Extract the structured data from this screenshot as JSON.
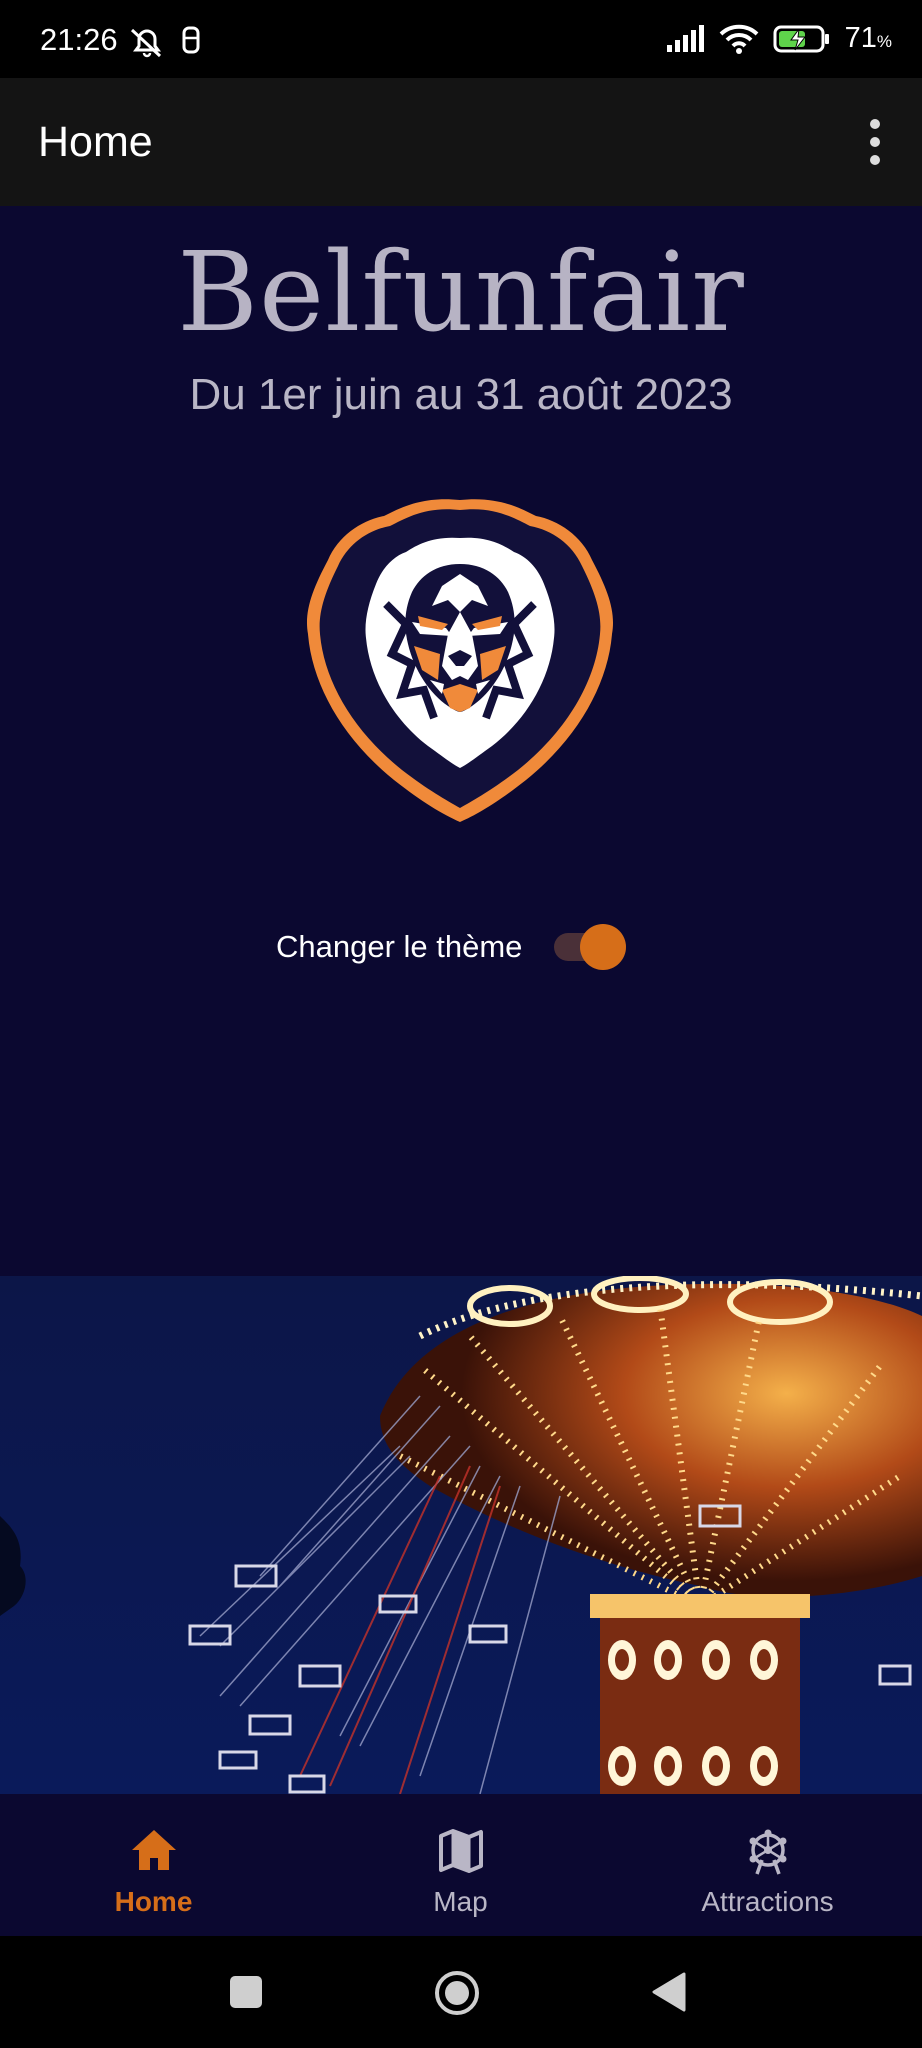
{
  "status_bar": {
    "time": "21:26",
    "battery_percent": "71",
    "battery_unit": "%"
  },
  "app_bar": {
    "title": "Home"
  },
  "hero": {
    "title": "Belfunfair",
    "subtitle": "Du 1er juin au 31 août 2023"
  },
  "theme": {
    "label": "Changer le thème",
    "toggle_on": true
  },
  "bottom_nav": {
    "items": [
      {
        "label": "Home",
        "icon": "home-icon",
        "active": true
      },
      {
        "label": "Map",
        "icon": "map-icon",
        "active": false
      },
      {
        "label": "Attractions",
        "icon": "ferris-wheel-icon",
        "active": false
      }
    ]
  },
  "colors": {
    "background": "#0b0830",
    "app_bar": "#141414",
    "accent": "#d66e19",
    "text_muted": "#b9b6c6"
  }
}
